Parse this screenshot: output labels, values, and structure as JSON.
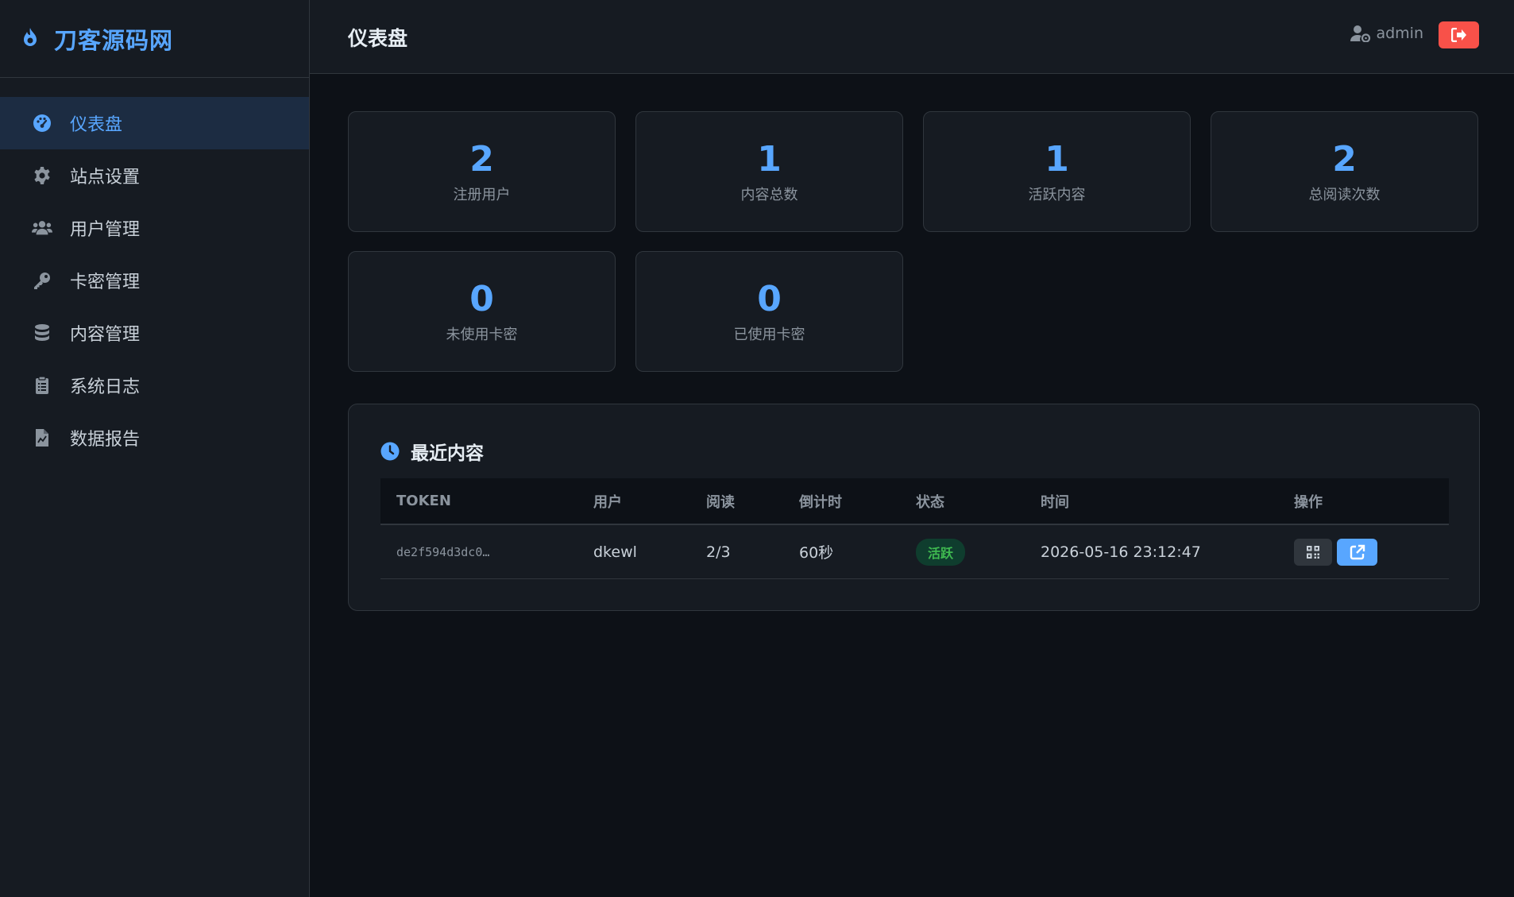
{
  "brand": {
    "title": "刀客源码网"
  },
  "sidebar": {
    "items": [
      {
        "label": "仪表盘",
        "icon": "dashboard-icon",
        "active": true
      },
      {
        "label": "站点设置",
        "icon": "gear-icon"
      },
      {
        "label": "用户管理",
        "icon": "users-icon"
      },
      {
        "label": "卡密管理",
        "icon": "key-icon"
      },
      {
        "label": "内容管理",
        "icon": "database-icon"
      },
      {
        "label": "系统日志",
        "icon": "clipboard-icon"
      },
      {
        "label": "数据报告",
        "icon": "file-chart-icon"
      }
    ]
  },
  "header": {
    "title": "仪表盘",
    "username": "admin"
  },
  "stats": [
    {
      "value": "2",
      "label": "注册用户"
    },
    {
      "value": "1",
      "label": "内容总数"
    },
    {
      "value": "1",
      "label": "活跃内容"
    },
    {
      "value": "2",
      "label": "总阅读次数"
    },
    {
      "value": "0",
      "label": "未使用卡密"
    },
    {
      "value": "0",
      "label": "已使用卡密"
    }
  ],
  "recent": {
    "title": "最近内容",
    "columns": [
      "TOKEN",
      "用户",
      "阅读",
      "倒计时",
      "状态",
      "时间",
      "操作"
    ],
    "rows": [
      {
        "token": "de2f594d3dc0…",
        "user": "dkewl",
        "reads": "2/3",
        "countdown": "60秒",
        "status": "活跃",
        "time": "2026-05-16 23:12:47"
      }
    ]
  },
  "colors": {
    "accent": "#58a6ff",
    "danger": "#f85149",
    "success": "#3fb950",
    "background": "#0d1117",
    "surface": "#161b22"
  }
}
